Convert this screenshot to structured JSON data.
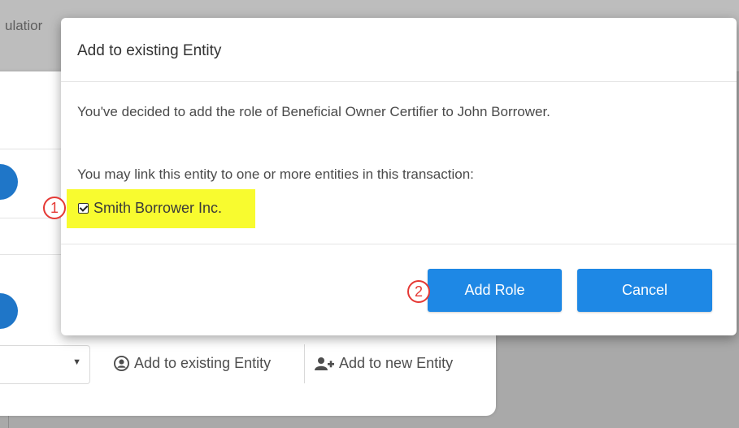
{
  "background": {
    "tab_text": "ulatior",
    "links": [
      {
        "label": "Add to existing Entity",
        "icon": "user-circle-icon"
      },
      {
        "label": "Add to new Entity",
        "icon": "add-user-icon"
      }
    ]
  },
  "dialog": {
    "title": "Add to existing Entity",
    "message": "You've decided to add the role of Beneficial Owner Certifier to John Borrower.",
    "link_prompt": "You may link this entity to one or more entities in this transaction:",
    "entity_option": {
      "label": "Smith Borrower Inc.",
      "checked": true
    },
    "buttons": {
      "add_role": "Add Role",
      "cancel": "Cancel"
    }
  },
  "callouts": [
    "1",
    "2"
  ],
  "colors": {
    "primary_button": "#1e88e5",
    "highlight": "#f8fb2f",
    "callout": "#e53935",
    "overlay": "#a9a9a9"
  }
}
